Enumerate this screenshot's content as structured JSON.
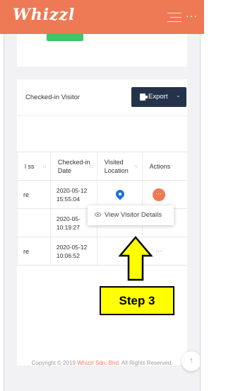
{
  "app": {
    "logo_text": "Whizzl",
    "brand_color": "#ee7a55"
  },
  "header": {
    "menu_icon": "hamburger-menu-icon",
    "more_icon": "more-dots-icon",
    "more_glyph": "···"
  },
  "panel": {
    "title": "Checked-in Visitor",
    "export_label": "Export",
    "export_chevron": "⌄"
  },
  "table": {
    "columns": [
      {
        "label": "l ss",
        "sort": "↑↓"
      },
      {
        "label": "Checked-in Date",
        "sort": "↑↓"
      },
      {
        "label": "Visited Location",
        "sort": "↑↓"
      },
      {
        "label": "Actions"
      }
    ],
    "rows": [
      {
        "col1": "re",
        "date": "2020-05-12 15:55:04",
        "location_icon": "map-pin-icon",
        "action": "···"
      },
      {
        "col1": "",
        "date": "2020-05- 10:19:27",
        "location_icon": "",
        "action": ""
      },
      {
        "col1": "re",
        "date": "2020-05-12 10:06:52",
        "location_icon": "",
        "action": "···"
      }
    ]
  },
  "popover": {
    "label": "View Visitor Details",
    "icon": "eye-icon"
  },
  "annotation": {
    "step_label": "Step 3"
  },
  "footer": {
    "prefix": "Copyright © 2019 ",
    "brand": "Whizzl Sdn. Bhd.",
    "suffix": " All Rights Reserved."
  },
  "scroll_top": {
    "glyph": "↑"
  }
}
